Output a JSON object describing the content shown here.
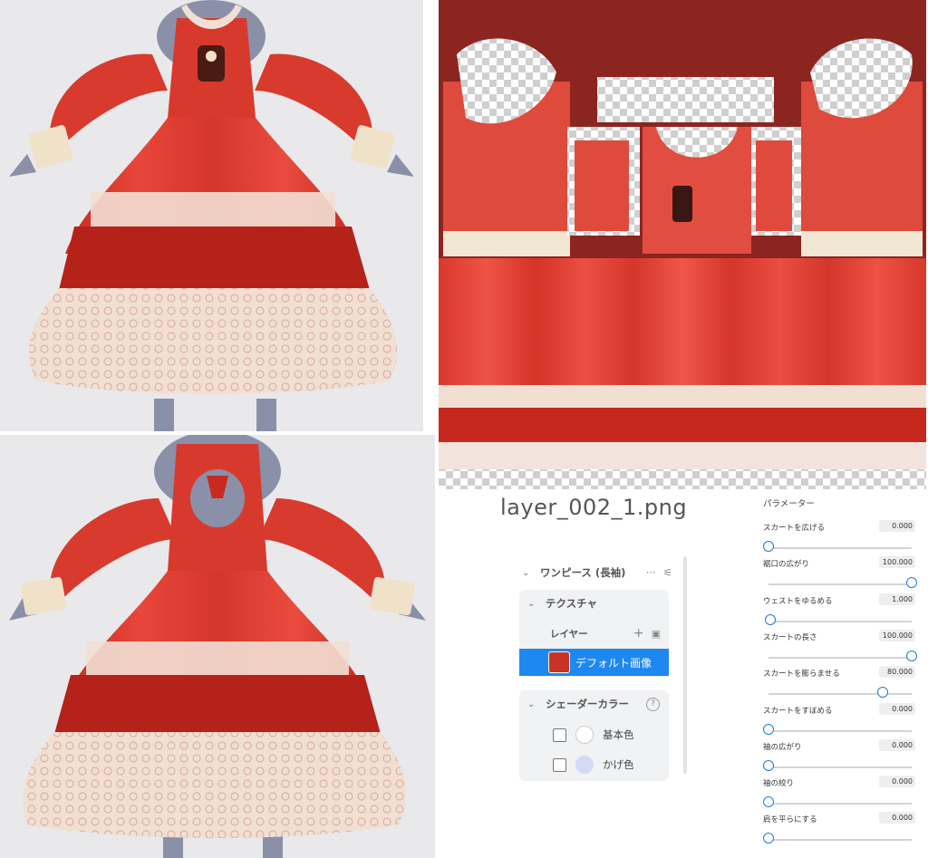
{
  "texture": {
    "filename": "layer_002_1.png"
  },
  "layer_panel": {
    "item_title": "ワンピース (長袖)",
    "more_icon": "more-horizontal-icon",
    "settings_icon": "sliders-icon",
    "texture_section": "テクスチャ",
    "layer_label": "レイヤー",
    "layers": [
      {
        "label": "デフォルト画像",
        "selected": true
      }
    ],
    "shader_section": "シェーダーカラー",
    "help_icon": "question-circle-icon",
    "shader_colors": [
      {
        "label": "基本色",
        "color": "#ffffff",
        "checked": false
      },
      {
        "label": "かげ色",
        "color": "#d6d9f5",
        "checked": false
      }
    ]
  },
  "parameters": {
    "title": "パラメーター",
    "accent_color": "#1e78e0",
    "items": [
      {
        "label": "スカートを広げる",
        "value": "0.000",
        "ratio": 0.0
      },
      {
        "label": "裾口の広がり",
        "value": "100.000",
        "ratio": 1.0
      },
      {
        "label": "ウェストをゆるめる",
        "value": "1.000",
        "ratio": 0.01
      },
      {
        "label": "スカートの長さ",
        "value": "100.000",
        "ratio": 1.0
      },
      {
        "label": "スカートを膨らませる",
        "value": "80.000",
        "ratio": 0.8
      },
      {
        "label": "スカートをすぼめる",
        "value": "0.000",
        "ratio": 0.0
      },
      {
        "label": "袖の広がり",
        "value": "0.000",
        "ratio": 0.0
      },
      {
        "label": "袖の絞り",
        "value": "0.000",
        "ratio": 0.0
      },
      {
        "label": "肩を平らにする",
        "value": "0.000",
        "ratio": 0.0
      }
    ]
  },
  "colors": {
    "dress_red": "#d9362a",
    "dress_dark": "#9e1c14",
    "lace": "#f3e1d6",
    "skin": "#8a90a8",
    "texture_bg": "#8c2520"
  }
}
